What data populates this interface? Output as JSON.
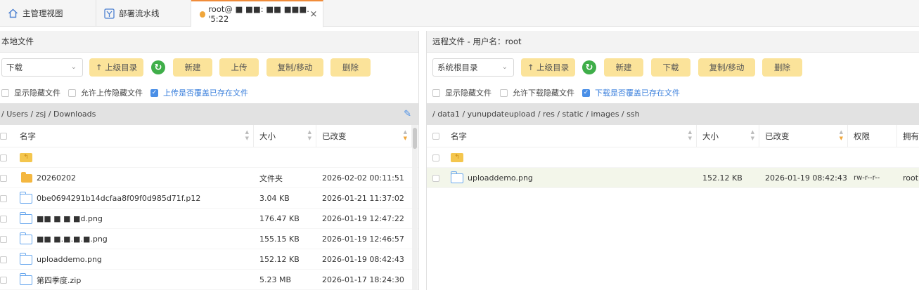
{
  "tabs": [
    {
      "label": "主管理视图",
      "icon": "home-icon"
    },
    {
      "label": "部署流水线",
      "icon": "pipeline-icon"
    },
    {
      "label": "root@ ■ ■■: ■■ ■■■. '5:22",
      "icon": "status-dot-icon",
      "close": "×"
    }
  ],
  "left": {
    "title": "本地文件",
    "dropdown": "下载",
    "buttons": {
      "up": "↑ 上级目录",
      "new": "新建",
      "upload": "上传",
      "copy_move": "复制/移动",
      "delete": "删除"
    },
    "options": [
      {
        "label": "显示隐藏文件",
        "checked": false
      },
      {
        "label": "允许上传隐藏文件",
        "checked": false
      },
      {
        "label": "上传是否覆盖已存在文件",
        "checked": true
      }
    ],
    "path": "/ Users / zsj / Downloads",
    "columns": {
      "name": "名字",
      "size": "大小",
      "modified": "已改变"
    },
    "rows": [
      {
        "type": "up",
        "name": "",
        "size": "",
        "modified": ""
      },
      {
        "type": "folder",
        "name": "20260202",
        "size": "文件夹",
        "modified": "2026-02-02 00:11:51"
      },
      {
        "type": "file",
        "name": "0be0694291b14dcfaa8f09f0d985d71f.p12",
        "size": "3.04 KB",
        "modified": "2026-01-21 11:37:02"
      },
      {
        "type": "file",
        "name": "■■ ■ ■ ■d.png",
        "size": "176.47 KB",
        "modified": "2026-01-19 12:47:22"
      },
      {
        "type": "file",
        "name": "■■ ■.■.■.■.png",
        "size": "155.15 KB",
        "modified": "2026-01-19 12:46:57"
      },
      {
        "type": "file",
        "name": "uploaddemo.png",
        "size": "152.12 KB",
        "modified": "2026-01-19 08:42:43"
      },
      {
        "type": "file",
        "name": "第四季度.zip",
        "size": "5.23 MB",
        "modified": "2026-01-17 18:24:30"
      }
    ]
  },
  "right": {
    "title": "远程文件 - 用户名：root",
    "dropdown": "系统根目录",
    "buttons": {
      "up": "↑ 上级目录",
      "new": "新建",
      "download": "下载",
      "copy_move": "复制/移动",
      "delete": "删除"
    },
    "options": [
      {
        "label": "显示隐藏文件",
        "checked": false
      },
      {
        "label": "允许下载隐藏文件",
        "checked": false
      },
      {
        "label": "下载是否覆盖已存在文件",
        "checked": true
      }
    ],
    "path": "/ data1 / yunupdateupload / res / static / images / ssh",
    "columns": {
      "name": "名字",
      "size": "大小",
      "modified": "已改变",
      "perm": "权限",
      "owner": "拥有"
    },
    "rows": [
      {
        "type": "up",
        "name": "",
        "size": "",
        "modified": "",
        "perm": "",
        "owner": ""
      },
      {
        "type": "file",
        "name": "uploaddemo.png",
        "size": "152.12 KB",
        "modified": "2026-01-19 08:42:43",
        "perm": "rw-r--r--",
        "owner": "root"
      }
    ]
  },
  "colors": {
    "accent": "#fbe39a",
    "tab_active": "#f08c3a",
    "check": "#4a8fe7",
    "refresh": "#3fae49",
    "folder": "#f4b740"
  }
}
